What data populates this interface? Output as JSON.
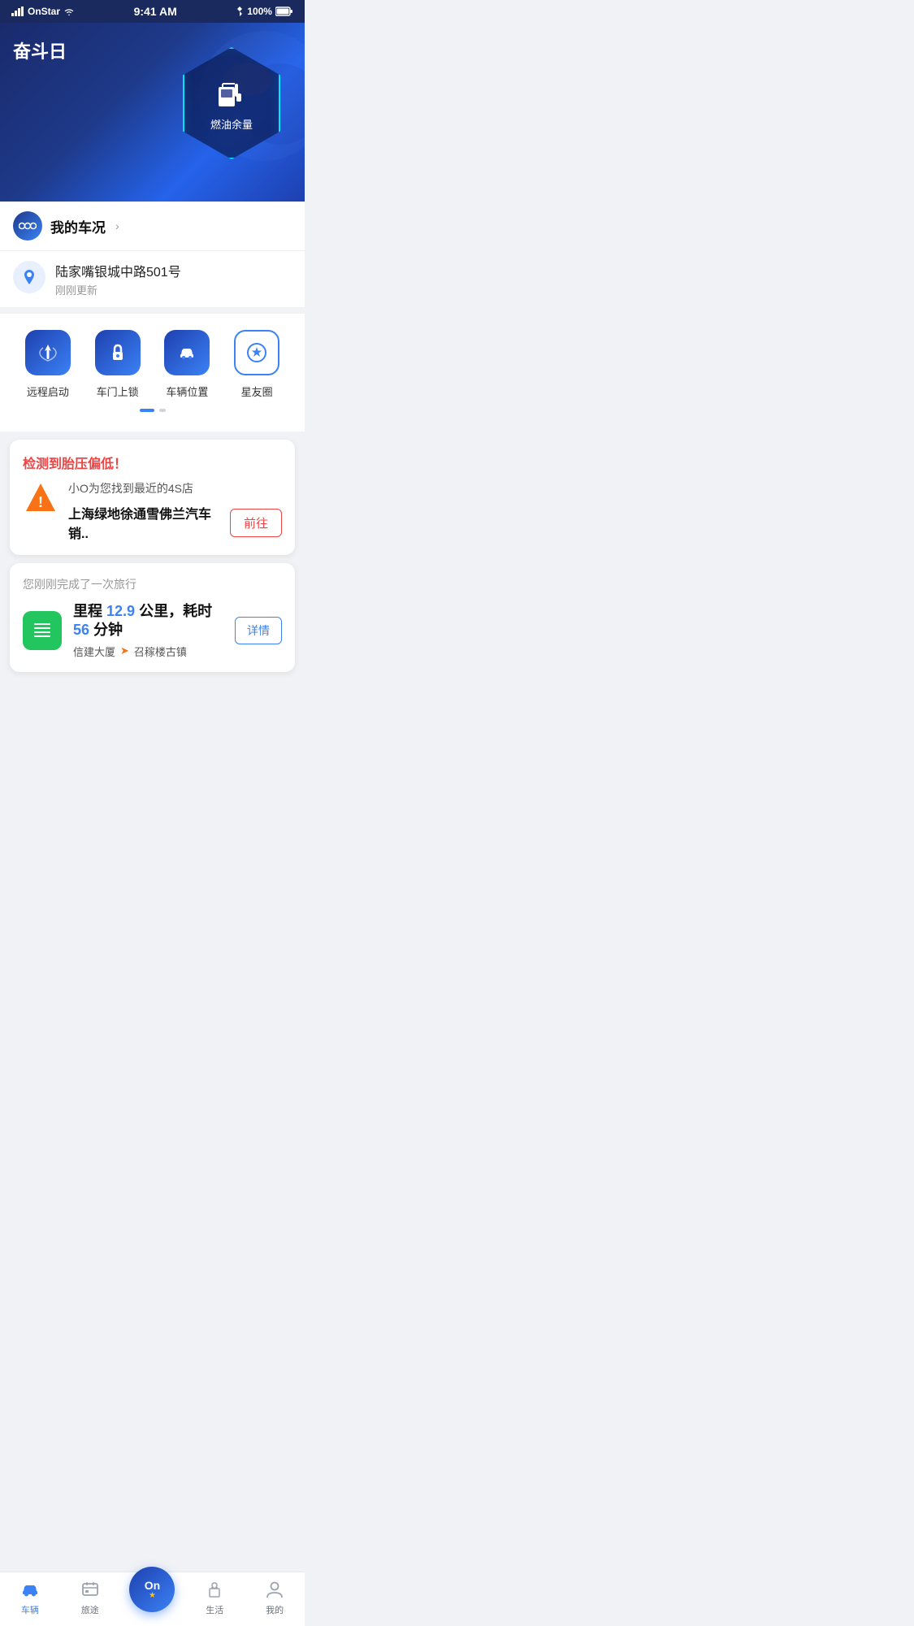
{
  "statusBar": {
    "carrier": "OnStar",
    "time": "9:41 AM",
    "battery": "100%"
  },
  "hero": {
    "title": "奋斗日",
    "hexLabel": "燃油余量"
  },
  "carStatus": {
    "label": "我的车况",
    "chevron": "›"
  },
  "location": {
    "address": "陆家嘴银城中路501号",
    "updateTime": "刚刚更新"
  },
  "actions": [
    {
      "id": "remote-start",
      "label": "远程启动"
    },
    {
      "id": "door-lock",
      "label": "车门上锁"
    },
    {
      "id": "car-location",
      "label": "车辆位置"
    },
    {
      "id": "star-circle",
      "label": "星友圈"
    }
  ],
  "alertCard": {
    "title": "检测到胎压偏低！",
    "subText": "小O为您找到最近的4S店",
    "shopName": "上海绿地徐通雪佛兰汽车销..",
    "goButton": "前往"
  },
  "tripCard": {
    "header": "您刚刚完成了一次旅行",
    "statsText1": "里程",
    "distance": "12.9",
    "statsText2": "公里，耗时",
    "duration": "56",
    "statsText3": "分钟",
    "from": "信建大厦",
    "to": "召稼楼古镇",
    "detailButton": "详情"
  },
  "bottomNav": [
    {
      "id": "vehicle",
      "label": "车辆",
      "active": true
    },
    {
      "id": "journey",
      "label": "旅途",
      "active": false
    },
    {
      "id": "center",
      "label": "On",
      "active": false
    },
    {
      "id": "life",
      "label": "生活",
      "active": false
    },
    {
      "id": "mine",
      "label": "我的",
      "active": false
    }
  ]
}
